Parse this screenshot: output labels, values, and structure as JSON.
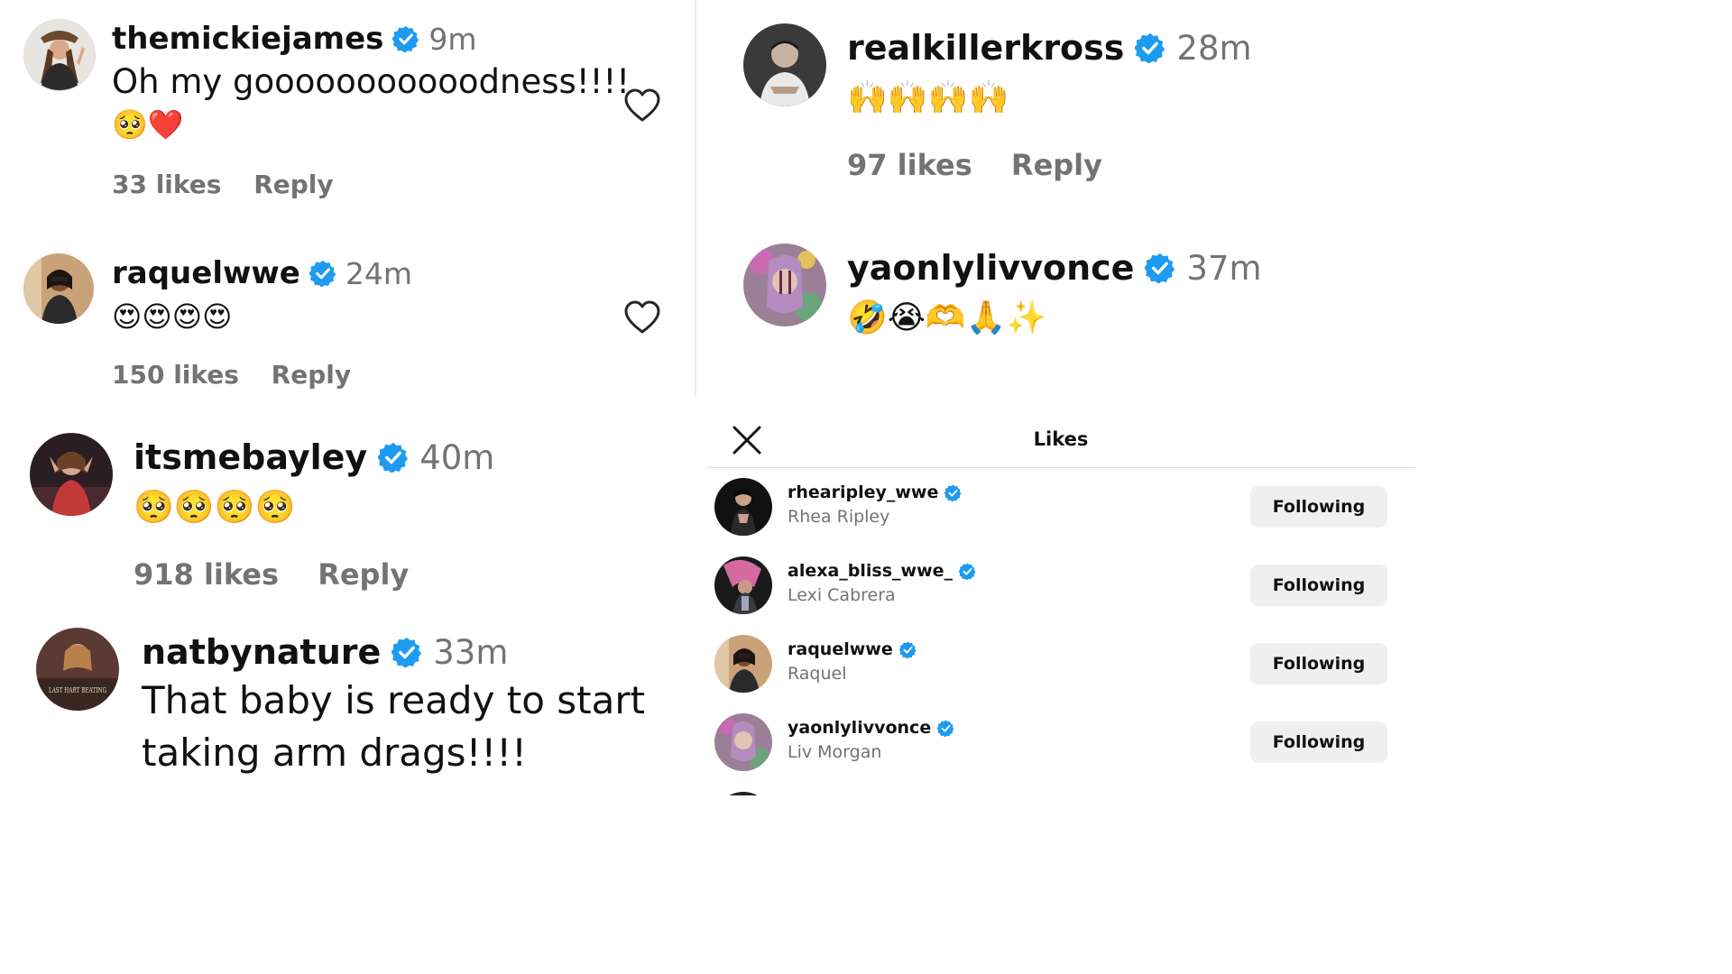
{
  "colors": {
    "verified": "#1d9bf0",
    "muted": "#737373",
    "text": "#111111",
    "button_bg": "#efefef"
  },
  "comments": {
    "c1": {
      "username": "themickiejames",
      "time": "9m",
      "text": "Oh my gooooooooooodness!!!!",
      "emojis": [
        "🥺",
        "❤️"
      ],
      "likes": "33 likes",
      "reply": "Reply"
    },
    "c2": {
      "username": "raquelwwe",
      "time": "24m",
      "emojis": [
        "😍",
        "😍",
        "😍",
        "😍"
      ],
      "likes": "150 likes",
      "reply": "Reply"
    },
    "c3": {
      "username": "realkillerkross",
      "time": "28m",
      "emojis": [
        "🙌",
        "🙌",
        "🙌",
        "🙌"
      ],
      "likes": "97 likes",
      "reply": "Reply"
    },
    "c4": {
      "username": "yaonlylivvonce",
      "time": "37m",
      "emojis": [
        "🤣",
        "😭",
        "🫶",
        "🙏",
        "✨"
      ]
    },
    "c5": {
      "username": "itsmebayley",
      "time": "40m",
      "emojis": [
        "🥺",
        "🥺",
        "🥺",
        "🥺"
      ],
      "likes": "918 likes",
      "reply": "Reply"
    },
    "c6": {
      "username": "natbynature",
      "time": "33m",
      "text_line1": "That baby is ready to start",
      "text_line2": "taking arm drags!!!!"
    }
  },
  "likes_panel": {
    "title": "Likes",
    "users": [
      {
        "username": "rhearipley_wwe",
        "fullname": "Rhea Ripley",
        "button": "Following"
      },
      {
        "username": "alexa_bliss_wwe_",
        "fullname": "Lexi Cabrera",
        "button": "Following"
      },
      {
        "username": "raquelwwe",
        "fullname": "Raquel",
        "button": "Following"
      },
      {
        "username": "yaonlylivvonce",
        "fullname": "Liv Morgan",
        "button": "Following"
      }
    ]
  },
  "avatar_texts": {
    "natbynature": "LAST HART BEATING"
  }
}
